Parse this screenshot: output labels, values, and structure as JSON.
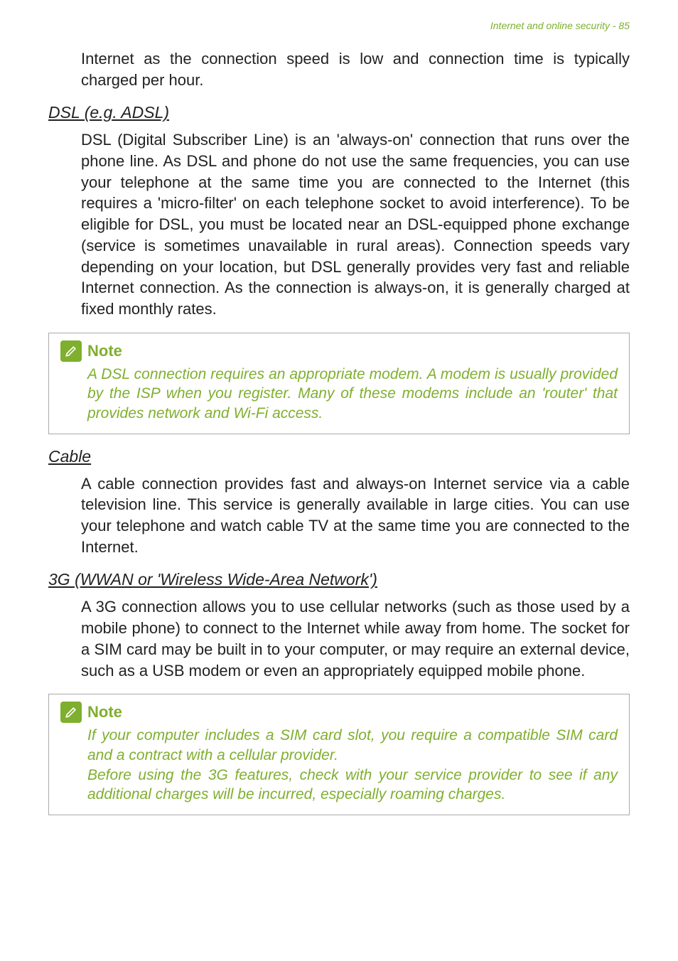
{
  "header": {
    "right_text": "Internet and online security - 85"
  },
  "intro_paragraph": "Internet as the connection speed is low and connection time is typically charged per hour.",
  "sections": {
    "dsl": {
      "heading": "DSL (e.g. ADSL)",
      "body": "DSL (Digital Subscriber Line) is an 'always-on' connection that runs over the phone line. As DSL and phone do not use the same frequencies, you can use your telephone at the same time you are connected to the Internet (this requires a 'micro-filter' on each telephone socket to avoid interference). To be eligible for DSL, you must be located near an DSL-equipped phone exchange (service is sometimes unavailable in rural areas). Connection speeds vary depending on your location, but DSL generally provides very fast and reliable Internet connection. As the connection is always-on, it is generally charged at fixed monthly rates."
    },
    "cable": {
      "heading": "Cable",
      "body": "A cable connection provides fast and always-on Internet service via a cable television line. This service is generally available in large cities. You can use your telephone and watch cable TV at the same time you are connected to the Internet."
    },
    "wwan": {
      "heading": "3G (WWAN or 'Wireless Wide-Area Network')",
      "body": "A 3G connection allows you to use cellular networks (such as those used by a mobile phone) to connect to the Internet while away from home. The socket for a SIM card may be built in to your computer, or may require an external device, such as a USB modem or even an appropriately equipped mobile phone."
    }
  },
  "notes": {
    "dsl_note": {
      "title": "Note",
      "body": "A DSL connection requires an appropriate modem. A modem is usually provided by the ISP when you register. Many of these modems include an 'router' that provides network and Wi-Fi access."
    },
    "wwan_note": {
      "title": "Note",
      "body_line1": "If your computer includes a SIM card slot, you require a compatible SIM card and a contract with a cellular provider.",
      "body_line2": "Before using the 3G features, check with your service provider to see if any additional charges will be incurred, especially roaming charges."
    }
  }
}
